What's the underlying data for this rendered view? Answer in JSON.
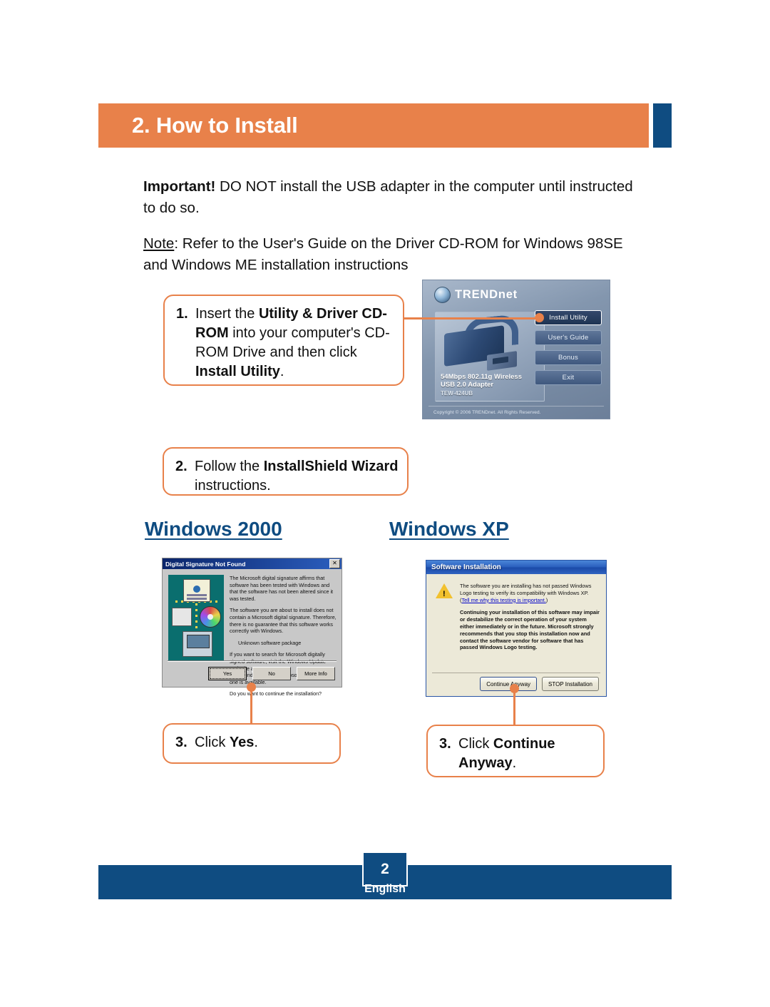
{
  "colors": {
    "orange": "#E8814A",
    "blue": "#0F4C81",
    "white": "#FFFFFF"
  },
  "header": {
    "title": "2. How to Install"
  },
  "body": {
    "important_label": "Important!",
    "important_text": " DO NOT install the USB adapter in the computer until instructed to do so.",
    "note_label": "Note",
    "note_text": ": Refer to the User's Guide on the Driver CD-ROM for Windows 98SE and Windows ME installation instructions"
  },
  "callouts": [
    {
      "number": "1.",
      "text_parts": [
        "Insert the ",
        "Utility & Driver CD-ROM",
        " into your computer's CD-ROM Drive and then click ",
        "Install Utility",
        "."
      ]
    },
    {
      "number": "2.",
      "text_parts": [
        "Follow the ",
        "InstallShield Wizard",
        " instructions."
      ]
    },
    {
      "number": "3.",
      "text_parts": [
        "Click ",
        "Yes",
        "."
      ]
    },
    {
      "number": "3.",
      "text_parts": [
        "Click ",
        "Continue Anyway",
        "."
      ]
    }
  ],
  "os_headings": {
    "win2000": "Windows 2000",
    "winxp": "Windows XP"
  },
  "autorun": {
    "brand": "TRENDnet",
    "buttons": [
      {
        "label": "Install Utility",
        "highlighted": true
      },
      {
        "label": "User's Guide",
        "highlighted": false
      },
      {
        "label": "Bonus",
        "highlighted": false
      },
      {
        "label": "Exit",
        "highlighted": false
      }
    ],
    "device_caption_line1": "54Mbps 802.11g Wireless",
    "device_caption_line2": "USB 2.0 Adapter",
    "device_model": "TEW-424UB",
    "copyright": "Copyright © 2006 TRENDnet. All Rights Reserved."
  },
  "win2000_dialog": {
    "title": "Digital Signature Not Found",
    "close_glyph": "✕",
    "paragraph1": "The Microsoft digital signature affirms that software has been tested with Windows and that the software has not been altered since it was tested.",
    "paragraph2": "The software you are about to install does not contain a Microsoft digital signature. Therefore, there is no guarantee that this software works correctly with Windows.",
    "paragraph3": "Unknown software package",
    "paragraph4": "If you want to search for Microsoft digitally signed software, visit the Windows Update Web site at http://windowsupdate.microsoft.com to see if one is available.",
    "paragraph5": "Do you want to continue the installation?",
    "buttons": [
      {
        "label": "Yes",
        "default": true
      },
      {
        "label": "No",
        "default": false
      },
      {
        "label": "More Info",
        "default": false
      }
    ]
  },
  "winxp_dialog": {
    "title": "Software Installation",
    "warning_glyph": "!",
    "paragraph1_a": "The software you are installing has not passed Windows Logo testing to verify its compatibility with Windows XP. (",
    "paragraph1_link": "Tell me why this testing is important.",
    "paragraph1_b": ")",
    "paragraph2": "Continuing your installation of this software may impair or destabilize the correct operation of your system either immediately or in the future. Microsoft strongly recommends that you stop this installation now and contact the software vendor for software that has passed Windows Logo testing.",
    "buttons": [
      {
        "label": "Continue Anyway",
        "default": true
      },
      {
        "label": "STOP Installation",
        "default": false
      }
    ]
  },
  "footer": {
    "page_number": "2",
    "language": "English"
  }
}
